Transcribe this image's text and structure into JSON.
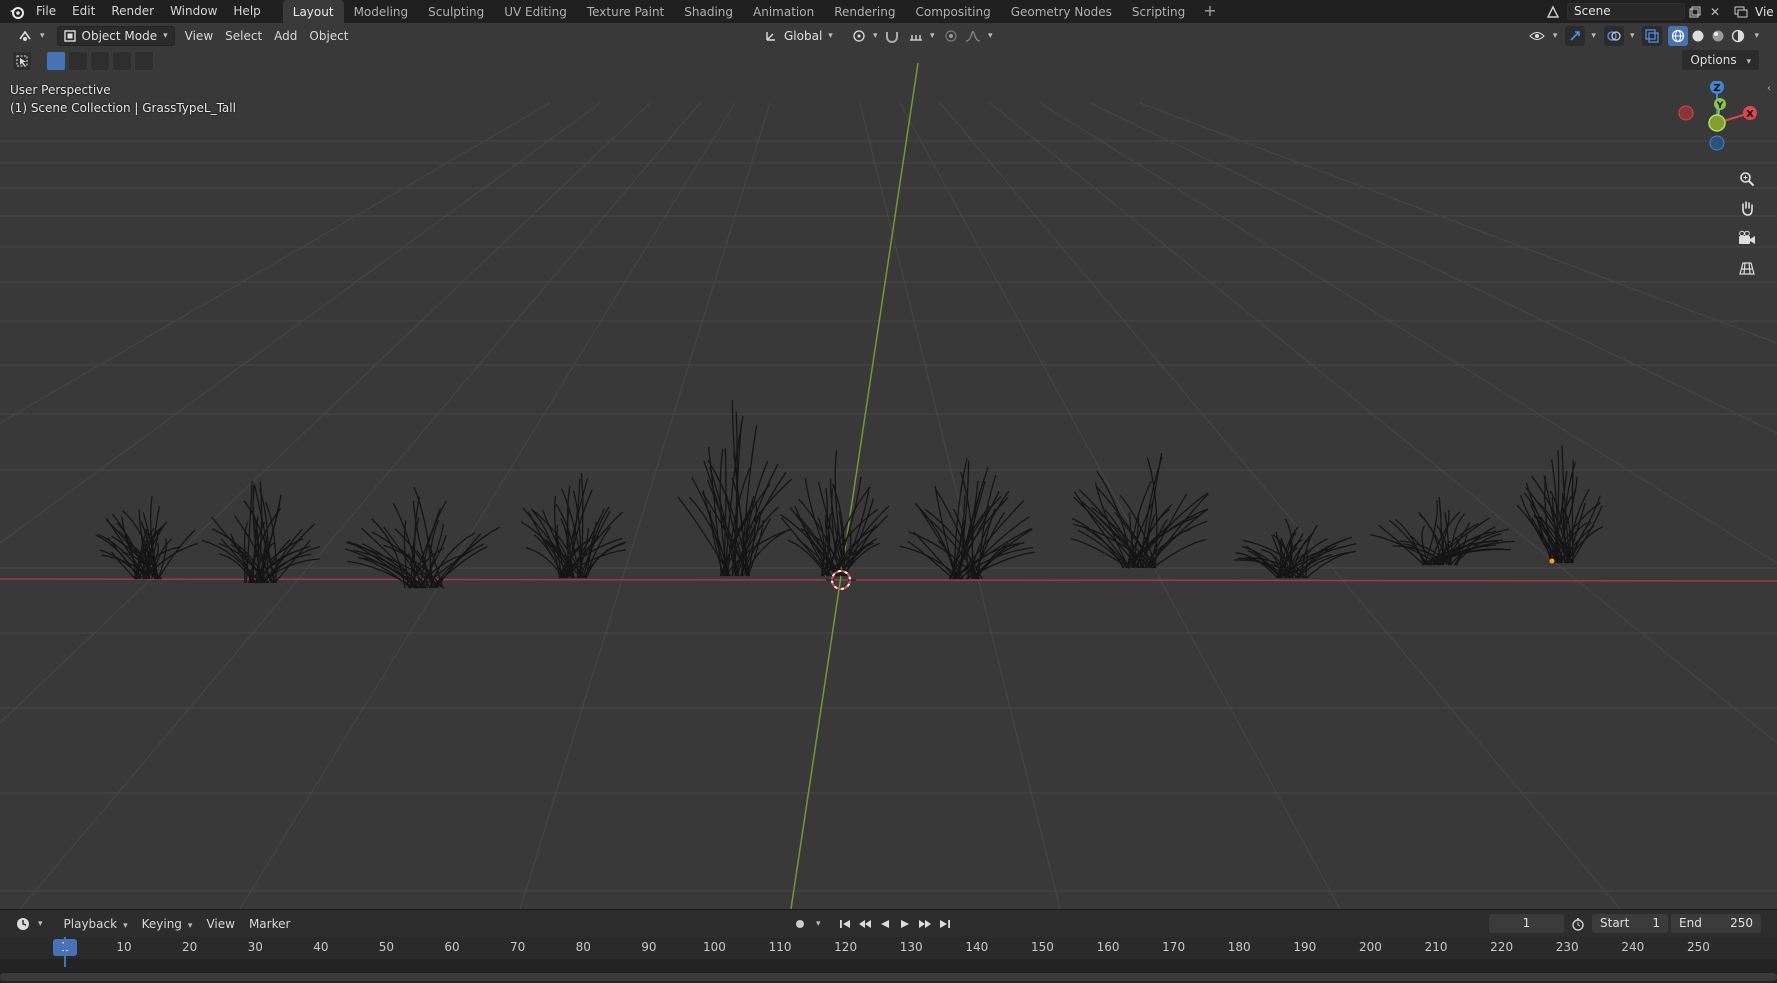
{
  "topbar": {
    "menus": [
      "File",
      "Edit",
      "Render",
      "Window",
      "Help"
    ],
    "workspaces": [
      "Layout",
      "Modeling",
      "Sculpting",
      "UV Editing",
      "Texture Paint",
      "Shading",
      "Animation",
      "Rendering",
      "Compositing",
      "Geometry Nodes",
      "Scripting"
    ],
    "active_workspace": "Layout",
    "add_tab": "+",
    "scene_name": "Scene",
    "view_layer_truncated": "Vie"
  },
  "viewport_header": {
    "mode": "Object Mode",
    "menus": [
      "View",
      "Select",
      "Add",
      "Object"
    ],
    "orientation": "Global",
    "options_label": "Options"
  },
  "viewport": {
    "perspective_label": "User Perspective",
    "collection_label": "(1) Scene Collection | GrassTypeL_Tall",
    "gizmo_axes": [
      "Z",
      "Y",
      "X"
    ],
    "gizmo_colors": {
      "x": "#e0464d",
      "y": "#8bc34a",
      "z": "#3d86d6"
    },
    "grid_color": "#4b4b4b",
    "background_color": "#393939",
    "x_axis_color": "#a33a44",
    "y_axis_color": "#6f9a35",
    "nav_icons": [
      "zoom-icon",
      "pan-hand-icon",
      "camera-icon",
      "grid-persp-icon"
    ]
  },
  "timeline": {
    "menus": [
      "Playback",
      "Keying",
      "View",
      "Marker"
    ],
    "current_frame": "1",
    "start_label": "Start",
    "start_value": "1",
    "end_label": "End",
    "end_value": "250",
    "ruler_ticks": [
      "10",
      "20",
      "30",
      "40",
      "50",
      "60",
      "70",
      "80",
      "90",
      "100",
      "110",
      "120",
      "130",
      "140",
      "150",
      "160",
      "170",
      "180",
      "190",
      "200",
      "210",
      "220",
      "230",
      "240",
      "250"
    ],
    "playhead_label": "1"
  }
}
